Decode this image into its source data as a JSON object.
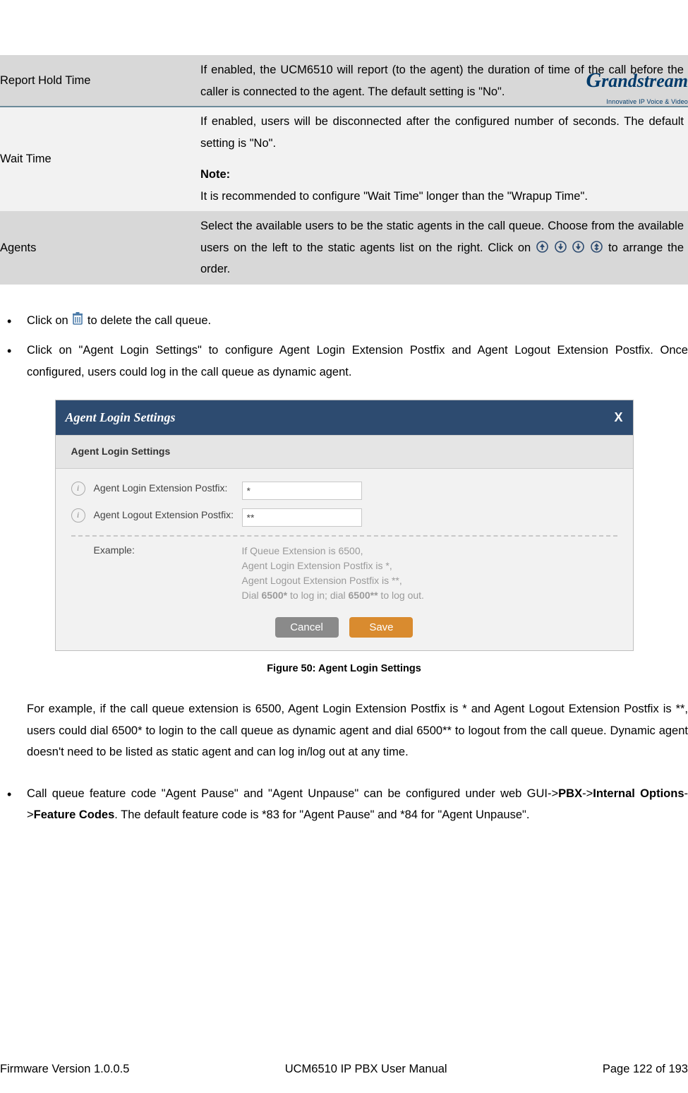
{
  "logo": {
    "brand": "Grandstream",
    "tagline": "Innovative IP Voice & Video"
  },
  "table": {
    "rows": [
      {
        "label": "Report Hold Time",
        "desc": "If enabled, the UCM6510 will report (to the agent) the duration of time of the call before the caller is connected to the agent. The default setting is \"No\"."
      },
      {
        "label": "Wait Time",
        "desc_p1": "If enabled, users will be disconnected after the configured number of seconds. The default setting is \"No\".",
        "note_label": "Note:",
        "desc_p2": "It is recommended to configure \"Wait Time\" longer than the \"Wrapup Time\"."
      },
      {
        "label": "Agents",
        "desc_before": "Select the available users to be the static agents in the call queue. Choose from the available users on the left to the static agents list on the right. Click on ",
        "desc_after": " to arrange the order."
      }
    ]
  },
  "bullets": {
    "b1_before": "Click on ",
    "b1_after": " to delete the call queue.",
    "b2": "Click on \"Agent Login Settings\" to configure Agent Login Extension Postfix and Agent Logout Extension Postfix. Once configured, users could log in the call queue as dynamic agent.",
    "b3_before": "Call queue feature code \"Agent Pause\" and \"Agent Unpause\" can be configured under web GUI->",
    "b3_bold1": "PBX",
    "b3_mid1": "->",
    "b3_bold2": "Internal Options",
    "b3_mid2": "->",
    "b3_bold3": "Feature Codes",
    "b3_after": ". The default feature code is *83 for \"Agent Pause\" and *84 for \"Agent Unpause\"."
  },
  "dialog": {
    "title": "Agent Login Settings",
    "close": "X",
    "subheader": "Agent Login Settings",
    "row1_label": "Agent Login Extension Postfix:",
    "row1_value": "*",
    "row2_label": "Agent Logout Extension Postfix:",
    "row2_value": "**",
    "example_label": "Example:",
    "example_l1": "If Queue Extension is 6500,",
    "example_l2": "Agent Login Extension Postfix is *,",
    "example_l3": "Agent Logout Extension Postfix is **,",
    "example_l4a": "Dial ",
    "example_l4b": "6500*",
    "example_l4c": " to log in; dial ",
    "example_l4d": "6500**",
    "example_l4e": " to log out.",
    "cancel": "Cancel",
    "save": "Save"
  },
  "figure_caption": "Figure 50: Agent Login Settings",
  "example_para": "For example, if the call queue extension is 6500, Agent Login Extension Postfix is * and Agent Logout Extension Postfix is **, users could dial 6500* to login to the call queue as dynamic agent and dial 6500** to logout from the call queue. Dynamic agent doesn't need to be listed as static agent and can log in/log out at any time.",
  "footer": {
    "left": "Firmware Version 1.0.0.5",
    "center": "UCM6510 IP PBX User Manual",
    "right": "Page 122 of 193"
  }
}
